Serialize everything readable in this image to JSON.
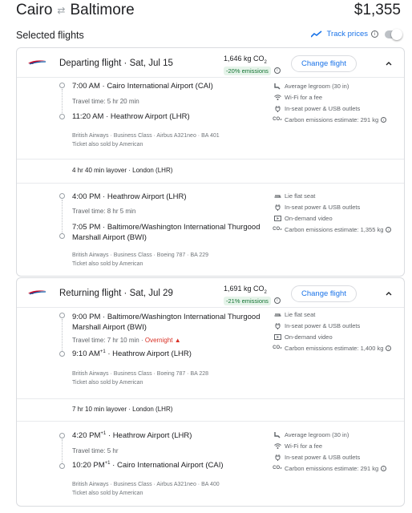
{
  "header": {
    "origin": "Cairo",
    "destination": "Baltimore",
    "swap_icon": "swap-arrows-icon",
    "price": "$1,355"
  },
  "selected": {
    "title": "Selected flights",
    "track_label": "Track prices",
    "track_enabled": false
  },
  "departing": {
    "title": "Departing flight",
    "date": "Sat, Jul 15",
    "co2_amount": "1,646 kg CO",
    "co2_sub": "2",
    "co2_pct": "-20% emissions",
    "change_label": "Change flight",
    "leg1": {
      "dep_time": "7:00 AM",
      "dep_airport": "Cairo International Airport (CAI)",
      "travel_time": "Travel time: 5 hr 20 min",
      "arr_time": "11:20 AM",
      "arr_airport": "Heathrow Airport (LHR)",
      "details": "British Airways · Business Class · Airbus A321neo · BA 401",
      "sold_by": "Ticket also sold by American",
      "amenities": [
        {
          "icon": "legroom-icon",
          "text": "Average legroom (30 in)"
        },
        {
          "icon": "wifi-icon",
          "text": "Wi-Fi for a fee"
        },
        {
          "icon": "power-icon",
          "text": "In-seat power & USB outlets"
        },
        {
          "icon": "co2-icon",
          "text": "Carbon emissions estimate: 291 kg"
        }
      ]
    },
    "layover": "4 hr 40 min layover · London (LHR)",
    "leg2": {
      "dep_time": "4:00 PM",
      "dep_airport": "Heathrow Airport (LHR)",
      "travel_time": "Travel time: 8 hr 5 min",
      "arr_time": "7:05 PM",
      "arr_airport_line1": "Baltimore/Washington International Thurgood",
      "arr_airport_line2": "Marshall Airport (BWI)",
      "details": "British Airways · Business Class · Boeing 787 · BA 229",
      "sold_by": "Ticket also sold by American",
      "amenities": [
        {
          "icon": "lie-flat-seat-icon",
          "text": "Lie flat seat"
        },
        {
          "icon": "power-icon",
          "text": "In-seat power & USB outlets"
        },
        {
          "icon": "video-icon",
          "text": "On-demand video"
        },
        {
          "icon": "co2-icon",
          "text": "Carbon emissions estimate: 1,355 kg"
        }
      ]
    }
  },
  "returning": {
    "title": "Returning flight",
    "date": "Sat, Jul 29",
    "co2_amount": "1,691 kg CO",
    "co2_sub": "2",
    "co2_pct": "-21% emissions",
    "change_label": "Change flight",
    "leg1": {
      "dep_time": "9:00 PM",
      "dep_airport_line1": "Baltimore/Washington International Thurgood",
      "dep_airport_line2": "Marshall Airport (BWI)",
      "travel_time": "Travel time: 7 hr 10 min",
      "overnight": "Overnight",
      "arr_time": "9:10 AM",
      "arr_day": "+1",
      "arr_airport": "Heathrow Airport (LHR)",
      "details": "British Airways · Business Class · Boeing 787 · BA 228",
      "sold_by": "Ticket also sold by American",
      "amenities": [
        {
          "icon": "lie-flat-seat-icon",
          "text": "Lie flat seat"
        },
        {
          "icon": "power-icon",
          "text": "In-seat power & USB outlets"
        },
        {
          "icon": "video-icon",
          "text": "On-demand video"
        },
        {
          "icon": "co2-icon",
          "text": "Carbon emissions estimate: 1,400 kg"
        }
      ]
    },
    "layover": "7 hr 10 min layover · London (LHR)",
    "leg2": {
      "dep_time": "4:20 PM",
      "dep_day": "+1",
      "dep_airport": "Heathrow Airport (LHR)",
      "travel_time": "Travel time: 5 hr",
      "arr_time": "10:20 PM",
      "arr_day": "+1",
      "arr_airport": "Cairo International Airport (CAI)",
      "details": "British Airways · Business Class · Airbus A321neo · BA 400",
      "sold_by": "Ticket also sold by American",
      "amenities": [
        {
          "icon": "legroom-icon",
          "text": "Average legroom (30 in)"
        },
        {
          "icon": "wifi-icon",
          "text": "Wi-Fi for a fee"
        },
        {
          "icon": "power-icon",
          "text": "In-seat power & USB outlets"
        },
        {
          "icon": "co2-icon",
          "text": "Carbon emissions estimate: 291 kg"
        }
      ]
    }
  },
  "colors": {
    "accent": "#1a73e8",
    "green": "#137333",
    "red": "#d93025"
  }
}
